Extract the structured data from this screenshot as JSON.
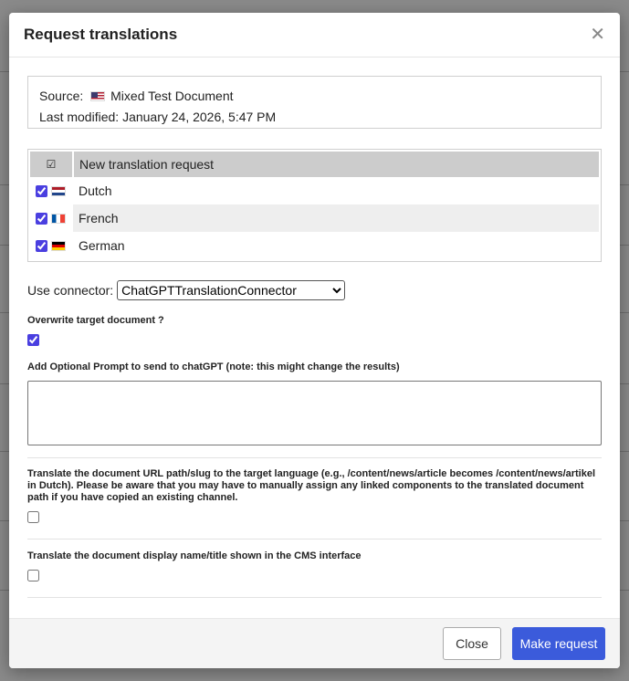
{
  "dialog": {
    "title": "Request translations",
    "close_icon": "close-icon"
  },
  "source": {
    "label": "Source:",
    "flag": "us-flag",
    "document": "Mixed Test Document",
    "modified_label": "Last modified:",
    "modified_value": "January 24, 2026, 5:47 PM"
  },
  "languages": {
    "header_icon": "checkbox-icon",
    "header_label": "New translation request",
    "items": [
      {
        "label": "Dutch",
        "flag": "nl-flag",
        "checked": true
      },
      {
        "label": "French",
        "flag": "fr-flag",
        "checked": true
      },
      {
        "label": "German",
        "flag": "de-flag",
        "checked": true
      }
    ]
  },
  "connector": {
    "label": "Use connector:",
    "selected": "ChatGPTTranslationConnector"
  },
  "overwrite": {
    "label": "Overwrite target document ?",
    "checked": true
  },
  "prompt": {
    "label": "Add Optional Prompt to send to chatGPT (note: this might change the results)",
    "value": ""
  },
  "translate_path": {
    "label": "Translate the document URL path/slug to the target language (e.g., /content/news/article becomes /content/news/artikel in Dutch). Please be aware that you may have to manually assign any linked components to the translated document path if you have copied an existing channel.",
    "checked": false
  },
  "translate_title": {
    "label": "Translate the document display name/title shown in the CMS interface",
    "checked": false
  },
  "footer": {
    "close_label": "Close",
    "submit_label": "Make request"
  },
  "colors": {
    "primary": "#3b5bdb",
    "checkbox": "#4a3fe0"
  }
}
